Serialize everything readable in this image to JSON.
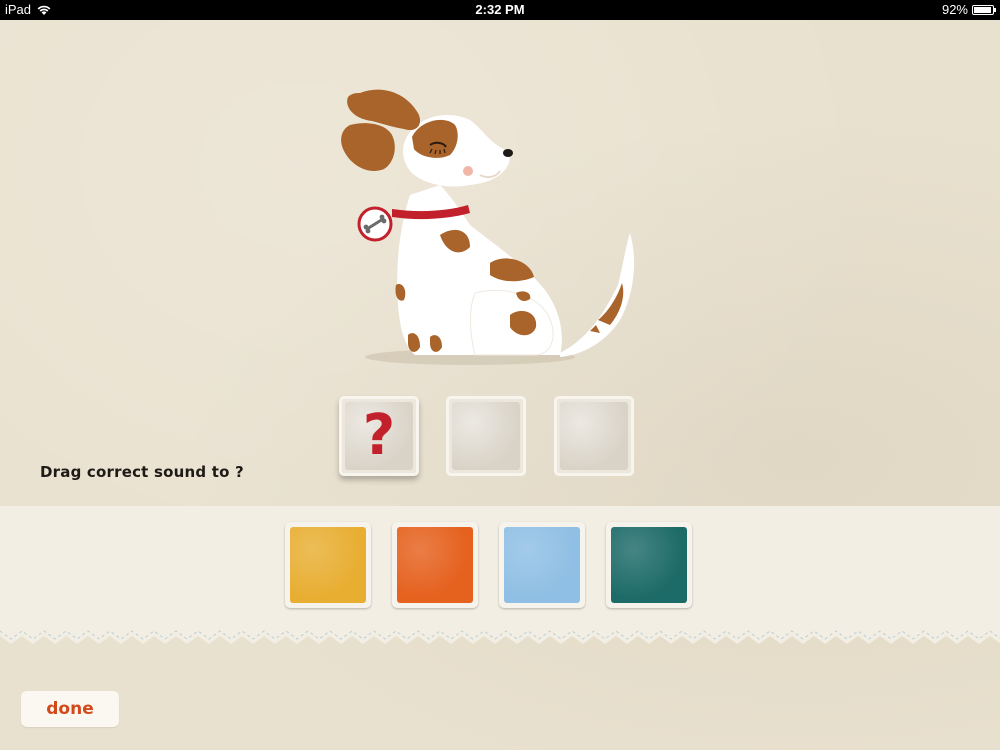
{
  "status_bar": {
    "device": "iPad",
    "time": "2:32 PM",
    "battery_percent": "92%",
    "battery_level": 0.92
  },
  "prompt": {
    "instruction": "Drag correct sound to ?",
    "placeholder_symbol": "?"
  },
  "scene": {
    "illustration": "dog-icon"
  },
  "answer_slots": [
    {
      "state": "question"
    },
    {
      "state": "empty"
    },
    {
      "state": "empty"
    }
  ],
  "sound_tiles": [
    {
      "color": "#e8ae32"
    },
    {
      "color": "#e5611e"
    },
    {
      "color": "#8fbfe4"
    },
    {
      "color": "#1d6b68"
    }
  ],
  "footer": {
    "done_label": "done"
  },
  "colors": {
    "accent_red": "#c2202a",
    "done_text": "#d24a1c",
    "background": "#e9e1cf"
  }
}
